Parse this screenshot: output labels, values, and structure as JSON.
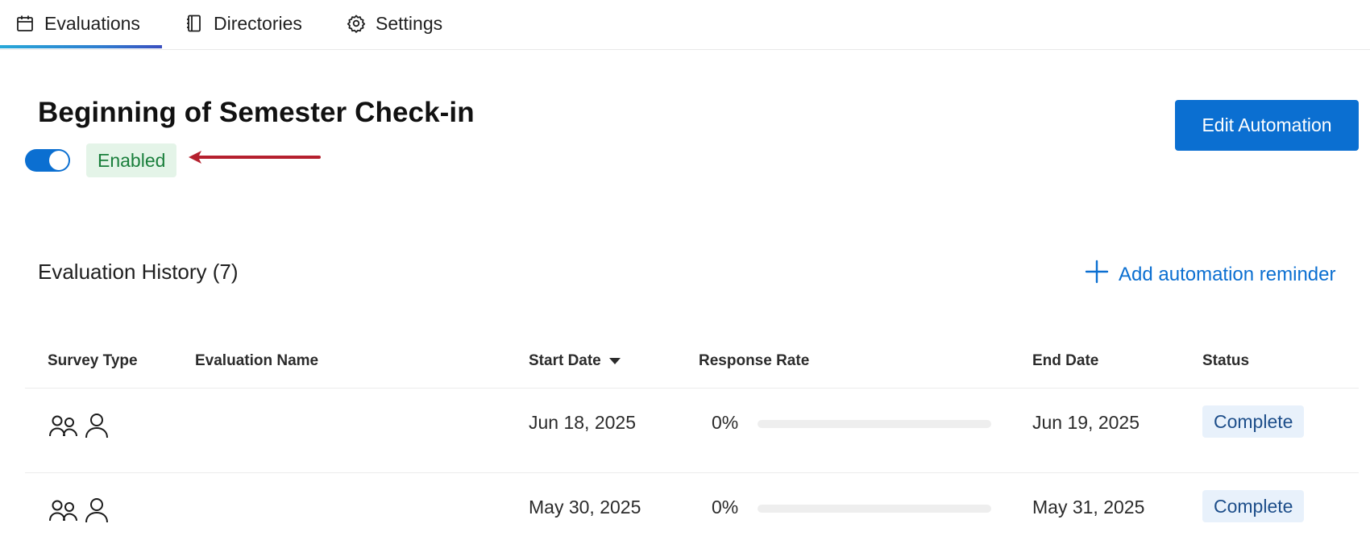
{
  "nav": {
    "tabs": [
      {
        "label": "Evaluations",
        "icon": "calendar-icon",
        "active": true
      },
      {
        "label": "Directories",
        "icon": "notebook-icon",
        "active": false
      },
      {
        "label": "Settings",
        "icon": "gear-icon",
        "active": false
      }
    ]
  },
  "header": {
    "title": "Beginning of Semester Check-in",
    "toggle_on": true,
    "status_label": "Enabled",
    "edit_button": "Edit Automation"
  },
  "history": {
    "title": "Evaluation History (7)",
    "add_reminder": "Add automation reminder"
  },
  "table": {
    "columns": [
      "Survey Type",
      "Evaluation Name",
      "Start Date",
      "Response Rate",
      "End Date",
      "Status"
    ],
    "sort_column": "Start Date",
    "sort_direction": "descending",
    "rows": [
      {
        "survey_type_icons": [
          "group-icon",
          "person-icon"
        ],
        "name": "",
        "start": "Jun 18, 2025",
        "rate": "0%",
        "rate_fraction": 0,
        "end": "Jun 19, 2025",
        "status": "Complete"
      },
      {
        "survey_type_icons": [
          "group-icon",
          "person-icon"
        ],
        "name": "",
        "start": "May 30, 2025",
        "rate": "0%",
        "rate_fraction": 0,
        "end": "May 31, 2025",
        "status": "Complete"
      }
    ]
  },
  "colors": {
    "accent": "#0b6fd1",
    "enabled_bg": "#e4f4e8",
    "enabled_text": "#1a7f3c",
    "status_bg": "#e8f1fb",
    "annotation_arrow": "#b5202e"
  }
}
